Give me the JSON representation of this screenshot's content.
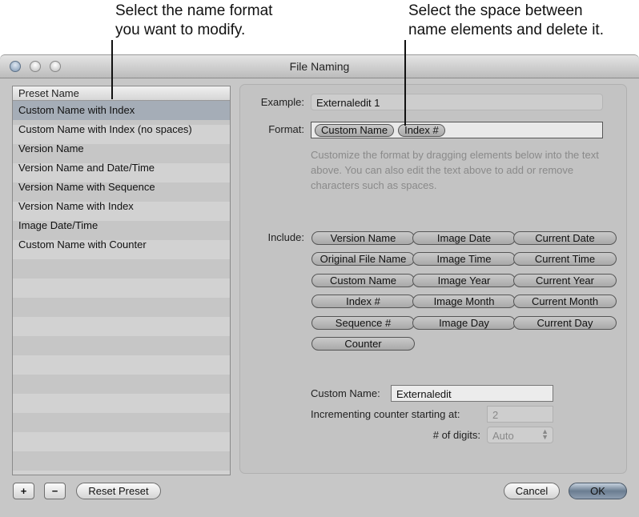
{
  "callouts": {
    "left": [
      "Select the name format",
      "you want to modify."
    ],
    "right": [
      "Select the space between",
      "name elements and delete it."
    ]
  },
  "window": {
    "title": "File Naming"
  },
  "preset_list": {
    "header": "Preset Name",
    "items": [
      "Custom Name with Index",
      "Custom Name with Index (no spaces)",
      "Version Name",
      "Version Name and Date/Time",
      "Version Name with Sequence",
      "Version Name with Index",
      "Image Date/Time",
      "Custom Name with Counter"
    ],
    "selected_index": 0
  },
  "example": {
    "label": "Example:",
    "value": "Externaledit 1"
  },
  "format": {
    "label": "Format:",
    "tokens": [
      "Custom Name",
      "Index #"
    ]
  },
  "help_text": "Customize the format by dragging elements below into the text above. You can also edit the text above to add or remove characters such as spaces.",
  "include": {
    "label": "Include:",
    "tokens": [
      "Version Name",
      "Image Date",
      "Current Date",
      "Original File Name",
      "Image Time",
      "Current Time",
      "Custom Name",
      "Image Year",
      "Current Year",
      "Index #",
      "Image Month",
      "Current Month",
      "Sequence #",
      "Image Day",
      "Current Day",
      "Counter"
    ]
  },
  "custom_name": {
    "label": "Custom Name:",
    "value": "Externaledit"
  },
  "counter": {
    "label": "Incrementing counter starting at:",
    "value": "2"
  },
  "digits": {
    "label": "# of digits:",
    "value": "Auto"
  },
  "buttons": {
    "add": "+",
    "remove": "−",
    "reset": "Reset Preset",
    "cancel": "Cancel",
    "ok": "OK"
  }
}
